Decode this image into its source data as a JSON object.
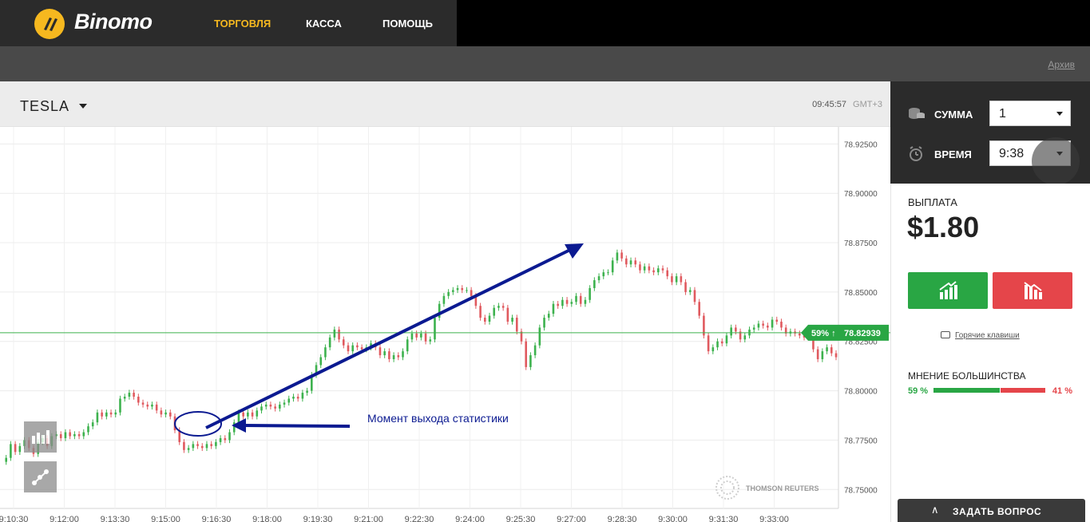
{
  "app": {
    "name": "Binomo"
  },
  "nav": {
    "items": [
      "ТОРГОВЛЯ",
      "КАССА",
      "ПОМОЩЬ"
    ],
    "active": 0
  },
  "subbar": {
    "archive": "Архив"
  },
  "chart_header": {
    "asset": "TESLA",
    "time": "09:45:57",
    "tz": "GMT+3"
  },
  "chart_data": {
    "type": "line",
    "asset": "TESLA",
    "x_ticks": [
      "9:10:30",
      "9:12:00",
      "9:13:30",
      "9:15:00",
      "9:16:30",
      "9:18:00",
      "9:19:30",
      "9:21:00",
      "9:22:30",
      "9:24:00",
      "9:25:30",
      "9:27:00",
      "9:28:30",
      "9:30:00",
      "9:31:30",
      "9:33:00"
    ],
    "y_ticks": [
      "78.92500",
      "78.90000",
      "78.87500",
      "78.85000",
      "78.82500",
      "78.80000",
      "78.77500",
      "78.75000"
    ],
    "ylim": [
      78.74,
      78.93
    ],
    "current_price": "78.82939",
    "current_price_value": 78.82939,
    "badge": "59% ↑",
    "annotation": "Момент выхода статистики",
    "watermark": "THOMSON REUTERS",
    "grid": true,
    "prices": [
      78.764,
      78.766,
      78.773,
      78.769,
      78.772,
      78.775,
      78.771,
      78.768,
      78.774,
      78.776,
      78.772,
      78.777,
      78.778,
      78.776,
      78.779,
      78.777,
      78.778,
      78.777,
      78.779,
      78.782,
      78.784,
      78.789,
      78.787,
      78.789,
      78.788,
      78.789,
      78.796,
      78.797,
      78.799,
      78.797,
      78.794,
      78.793,
      78.792,
      78.793,
      78.79,
      78.788,
      78.789,
      78.787,
      78.78,
      78.774,
      78.77,
      78.771,
      78.773,
      78.772,
      78.771,
      78.773,
      78.772,
      78.774,
      78.776,
      78.775,
      78.779,
      78.784,
      78.789,
      78.787,
      78.789,
      78.787,
      78.79,
      78.792,
      78.793,
      78.792,
      78.791,
      78.793,
      78.794,
      78.796,
      78.797,
      78.796,
      78.799,
      78.8,
      78.808,
      78.813,
      78.817,
      78.822,
      78.827,
      78.831,
      78.826,
      78.823,
      78.82,
      78.823,
      78.822,
      78.821,
      78.822,
      78.824,
      78.822,
      78.818,
      78.82,
      78.816,
      78.818,
      78.817,
      78.82,
      78.826,
      78.829,
      78.827,
      78.829,
      78.825,
      78.826,
      78.837,
      78.844,
      78.848,
      78.85,
      78.851,
      78.852,
      78.851,
      78.851,
      78.848,
      78.843,
      78.837,
      78.835,
      78.838,
      78.842,
      78.843,
      78.842,
      78.835,
      78.837,
      78.83,
      78.825,
      78.812,
      78.818,
      78.823,
      78.832,
      78.837,
      78.839,
      78.844,
      78.843,
      78.846,
      78.844,
      78.845,
      78.848,
      78.844,
      78.846,
      78.852,
      78.856,
      78.858,
      78.86,
      78.86,
      78.866,
      78.87,
      78.867,
      78.864,
      78.866,
      78.864,
      78.861,
      78.863,
      78.861,
      78.86,
      78.862,
      78.861,
      78.858,
      78.855,
      78.858,
      78.855,
      78.85,
      78.851,
      78.845,
      78.838,
      78.828,
      78.82,
      78.822,
      78.825,
      78.824,
      78.828,
      78.832,
      78.83,
      78.826,
      78.828,
      78.831,
      78.832,
      78.834,
      78.833,
      78.832,
      78.836,
      78.835,
      78.832,
      78.829,
      78.83,
      78.829,
      78.828,
      78.827,
      78.83,
      78.821,
      78.816,
      78.82,
      78.822,
      78.819,
      78.817
    ]
  },
  "sidebar": {
    "sum_label": "СУММА",
    "sum_value": "1",
    "time_label": "ВРЕМЯ",
    "time_value": "9:38",
    "payout_label": "ВЫПЛАТА",
    "payout_value": "$1.80",
    "hotkeys": "Горячие клавиши",
    "majority_label": "МНЕНИЕ БОЛЬШИНСТВА",
    "majority_up": "59 %",
    "majority_down": "41 %",
    "majority_up_value": 59
  },
  "footer": {
    "ask": "ЗАДАТЬ ВОПРОС"
  },
  "colors": {
    "brand": "#f6b81f",
    "up": "#29a644",
    "down": "#e5454a",
    "arrow": "#0b1a91"
  }
}
